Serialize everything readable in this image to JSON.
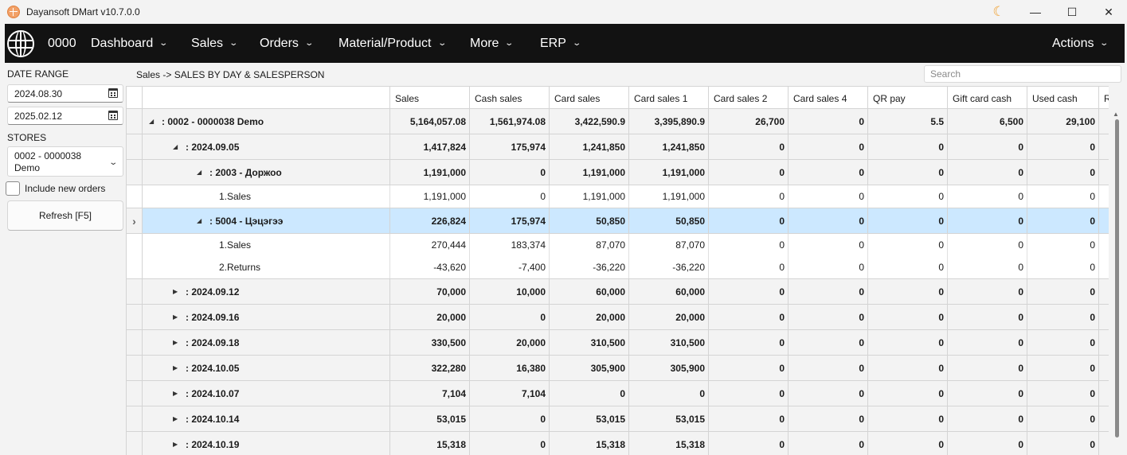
{
  "window": {
    "title": "Dayansoft DMart v10.7.0.0",
    "controls": {
      "minimize": "—",
      "maximize": "☐",
      "close": "✕",
      "theme": "☾"
    }
  },
  "nav": {
    "code": "0000",
    "items": [
      {
        "label": "Dashboard"
      },
      {
        "label": "Sales"
      },
      {
        "label": "Orders"
      },
      {
        "label": "Material/Product"
      },
      {
        "label": "More"
      },
      {
        "label": "ERP"
      }
    ],
    "actions": "Actions",
    "chevron": "⌄"
  },
  "left_panel": {
    "date_range_label": "DATE RANGE",
    "date_from": "2024.08.30",
    "date_to": "2025.02.12",
    "stores_label": "STORES",
    "store_line1": "0002 - 0000038",
    "store_line2": "Demo",
    "include_new_orders": "Include new orders",
    "refresh": "Refresh [F5]"
  },
  "breadcrumb": "Sales -> SALES BY DAY & SALESPERSON",
  "search_placeholder": "Search",
  "grid": {
    "columns": [
      "Sales",
      "Cash sales",
      "Card sales",
      "Card sales 1",
      "Card sales 2",
      "Card sales 4",
      "QR pay",
      "Gift card cash",
      "Used cash",
      "R"
    ],
    "rows": [
      {
        "level": 0,
        "type": "group",
        "expanded": true,
        "name": ": 0002 - 0000038 Demo",
        "values": [
          "5,164,057.08",
          "1,561,974.08",
          "3,422,590.9",
          "3,395,890.9",
          "26,700",
          "0",
          "5.5",
          "6,500",
          "29,100"
        ]
      },
      {
        "level": 1,
        "type": "group",
        "expanded": true,
        "name": ": 2024.09.05",
        "values": [
          "1,417,824",
          "175,974",
          "1,241,850",
          "1,241,850",
          "0",
          "0",
          "0",
          "0",
          "0"
        ]
      },
      {
        "level": 2,
        "type": "group",
        "expanded": true,
        "name": ": 2003 - Доржоо",
        "values": [
          "1,191,000",
          "0",
          "1,191,000",
          "1,191,000",
          "0",
          "0",
          "0",
          "0",
          "0"
        ]
      },
      {
        "level": 3,
        "type": "detail",
        "last": true,
        "name": "1.Sales",
        "values": [
          "1,191,000",
          "0",
          "1,191,000",
          "1,191,000",
          "0",
          "0",
          "0",
          "0",
          "0"
        ]
      },
      {
        "level": 2,
        "type": "group",
        "expanded": true,
        "selected": true,
        "name": ": 5004 - Цэцэгээ",
        "values": [
          "226,824",
          "175,974",
          "50,850",
          "50,850",
          "0",
          "0",
          "0",
          "0",
          "0"
        ]
      },
      {
        "level": 3,
        "type": "detail",
        "name": "1.Sales",
        "values": [
          "270,444",
          "183,374",
          "87,070",
          "87,070",
          "0",
          "0",
          "0",
          "0",
          "0"
        ]
      },
      {
        "level": 3,
        "type": "detail",
        "last": true,
        "name": "2.Returns",
        "values": [
          "-43,620",
          "-7,400",
          "-36,220",
          "-36,220",
          "0",
          "0",
          "0",
          "0",
          "0"
        ]
      },
      {
        "level": 1,
        "type": "group",
        "expanded": false,
        "name": ": 2024.09.12",
        "values": [
          "70,000",
          "10,000",
          "60,000",
          "60,000",
          "0",
          "0",
          "0",
          "0",
          "0"
        ]
      },
      {
        "level": 1,
        "type": "group",
        "expanded": false,
        "name": ": 2024.09.16",
        "values": [
          "20,000",
          "0",
          "20,000",
          "20,000",
          "0",
          "0",
          "0",
          "0",
          "0"
        ]
      },
      {
        "level": 1,
        "type": "group",
        "expanded": false,
        "name": ": 2024.09.18",
        "values": [
          "330,500",
          "20,000",
          "310,500",
          "310,500",
          "0",
          "0",
          "0",
          "0",
          "0"
        ]
      },
      {
        "level": 1,
        "type": "group",
        "expanded": false,
        "name": ": 2024.10.05",
        "values": [
          "322,280",
          "16,380",
          "305,900",
          "305,900",
          "0",
          "0",
          "0",
          "0",
          "0"
        ]
      },
      {
        "level": 1,
        "type": "group",
        "expanded": false,
        "name": ": 2024.10.07",
        "values": [
          "7,104",
          "7,104",
          "0",
          "0",
          "0",
          "0",
          "0",
          "0",
          "0"
        ]
      },
      {
        "level": 1,
        "type": "group",
        "expanded": false,
        "name": ": 2024.10.14",
        "values": [
          "53,015",
          "0",
          "53,015",
          "53,015",
          "0",
          "0",
          "0",
          "0",
          "0"
        ]
      },
      {
        "level": 1,
        "type": "group",
        "expanded": false,
        "name": ": 2024.10.19",
        "values": [
          "15,318",
          "0",
          "15,318",
          "15,318",
          "0",
          "0",
          "0",
          "0",
          "0"
        ]
      }
    ]
  }
}
